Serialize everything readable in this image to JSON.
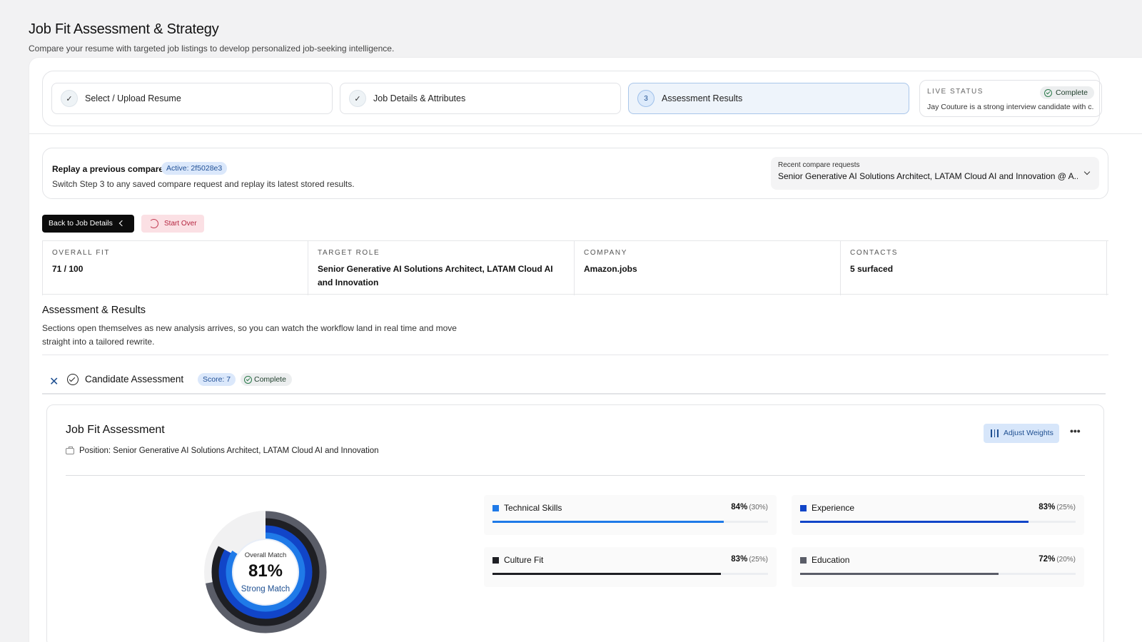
{
  "page": {
    "title": "Job Fit Assessment & Strategy",
    "subtitle": "Compare your resume with targeted job listings to develop personalized job-seeking intelligence."
  },
  "stepper": {
    "steps": [
      {
        "label": "Select / Upload Resume",
        "state": "done"
      },
      {
        "label": "Job Details & Attributes",
        "state": "done"
      },
      {
        "label": "Assessment Results",
        "state": "active",
        "number": "3"
      }
    ],
    "live_status": {
      "label": "LIVE STATUS",
      "badge": "Complete",
      "text": "Jay Couture is a strong interview candidate with c..."
    }
  },
  "replay": {
    "title": "Replay a previous compare",
    "badge": "Active: 2f5028e3",
    "description": "Switch Step 3 to any saved compare request and replay its latest stored results.",
    "recent_label": "Recent compare requests",
    "recent_value": "Senior Generative AI Solutions Architect, LATAM Cloud AI and Innovation @ A..."
  },
  "actions": {
    "back": "Back to Job Details",
    "start_over": "Start Over"
  },
  "stats": [
    {
      "label": "OVERALL FIT",
      "value": "71 / 100"
    },
    {
      "label": "TARGET ROLE",
      "value": "Senior Generative AI Solutions Architect, LATAM Cloud AI and Innovation"
    },
    {
      "label": "COMPANY",
      "value": "Amazon.jobs"
    },
    {
      "label": "CONTACTS",
      "value": "5 surfaced"
    }
  ],
  "section": {
    "title": "Assessment & Results",
    "description": "Sections open themselves as new analysis arrives, so you can watch the workflow land in real time and move straight into a tailored rewrite."
  },
  "accordion": {
    "title": "Candidate Assessment",
    "score": "Score: 7",
    "status": "Complete"
  },
  "job_fit": {
    "title": "Job Fit Assessment",
    "position": "Position: Senior Generative AI Solutions Architect, LATAM Cloud AI and Innovation",
    "adjust_label": "Adjust Weights",
    "more": "•••",
    "overall_label": "Overall Match",
    "overall_value": "81%",
    "overall_rating": "Strong Match",
    "overall_fraction": 0.81,
    "metrics": [
      {
        "name": "Technical Skills",
        "pct": "84%",
        "weight": "(30%)",
        "fraction": 0.84,
        "color": "#1f7ae8"
      },
      {
        "name": "Experience",
        "pct": "83%",
        "weight": "(25%)",
        "fraction": 0.83,
        "color": "#1145c8"
      },
      {
        "name": "Culture Fit",
        "pct": "83%",
        "weight": "(25%)",
        "fraction": 0.83,
        "color": "#1e1f24"
      },
      {
        "name": "Education",
        "pct": "72%",
        "weight": "(20%)",
        "fraction": 0.72,
        "color": "#5a5d68"
      }
    ]
  }
}
